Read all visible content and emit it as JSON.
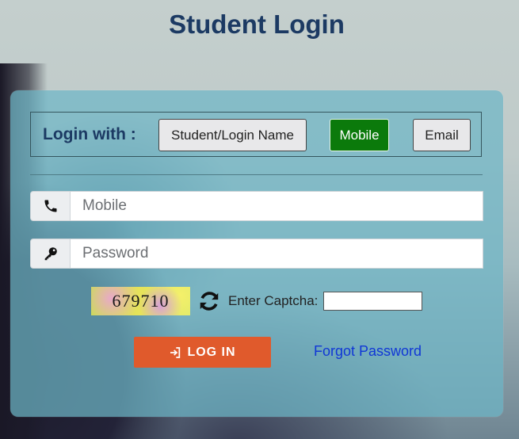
{
  "page": {
    "title": "Student Login"
  },
  "login_with": {
    "label": "Login with :",
    "options": [
      {
        "label": "Student/Login Name",
        "selected": false
      },
      {
        "label": "Mobile",
        "selected": true
      },
      {
        "label": "Email",
        "selected": false
      }
    ],
    "selected_color": "#0b7a0b"
  },
  "fields": {
    "mobile": {
      "placeholder": "Mobile",
      "value": "",
      "icon": "phone-icon"
    },
    "password": {
      "placeholder": "Password",
      "value": "",
      "icon": "key-icon"
    }
  },
  "captcha": {
    "code": "679710",
    "refresh_icon": "refresh-icon",
    "label": "Enter Captcha:",
    "value": ""
  },
  "actions": {
    "login_label": "LOG IN",
    "login_icon": "sign-in-icon",
    "login_color": "#e05a2c",
    "forgot_label": "Forgot Password"
  }
}
